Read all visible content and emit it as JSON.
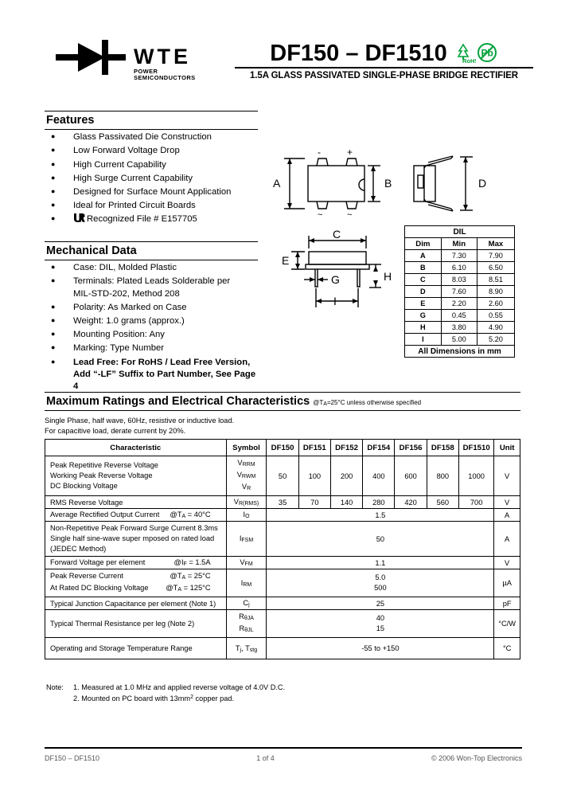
{
  "header": {
    "logo_text": "WTE",
    "logo_subtext": "POWER SEMICONDUCTORS",
    "title": "DF150 – DF1510",
    "subtitle": "1.5A GLASS PASSIVATED SINGLE-PHASE BRIDGE RECTIFIER",
    "rohs_label": "RoHS",
    "pb_label": "Pb"
  },
  "features": {
    "heading": "Features",
    "items": [
      "Glass Passivated Die Construction",
      "Low Forward Voltage Drop",
      "High Current Capability",
      "High Surge Current Capability",
      "Designed for Surface Mount Application",
      "Ideal for Printed Circuit Boards",
      "Recognized File # E157705"
    ],
    "ul_mark": "UR"
  },
  "mechanical": {
    "heading": "Mechanical Data",
    "items": [
      "Case: DIL, Molded Plastic",
      "Terminals: Plated Leads Solderable per",
      "Polarity: As Marked on Case",
      "Weight: 1.0 grams (approx.)",
      "Mounting Position: Any",
      "Marking: Type Number",
      "Lead Free: For RoHS / Lead Free Version,"
    ],
    "terminals_cont": "MIL-STD-202, Method 208",
    "leadfree_cont": "Add “-LF” Suffix to Part Number, See Page 4"
  },
  "drawing": {
    "labels": {
      "a": "A",
      "b": "B",
      "c": "C",
      "d": "D",
      "e": "E",
      "g": "G",
      "h": "H",
      "i": "I",
      "minus": "-",
      "plus": "+",
      "tilde1": "~",
      "tilde2": "~"
    }
  },
  "dil_table": {
    "title": "DIL",
    "headers": [
      "Dim",
      "Min",
      "Max"
    ],
    "rows": [
      [
        "A",
        "7.30",
        "7.90"
      ],
      [
        "B",
        "6.10",
        "6.50"
      ],
      [
        "C",
        "8.03",
        "8.51"
      ],
      [
        "D",
        "7.60",
        "8.90"
      ],
      [
        "E",
        "2.20",
        "2.60"
      ],
      [
        "G",
        "0.45",
        "0.55"
      ],
      [
        "H",
        "3.80",
        "4.90"
      ],
      [
        "I",
        "5.00",
        "5.20"
      ]
    ],
    "footer": "All Dimensions in mm"
  },
  "ratings": {
    "heading": "Maximum Ratings and Electrical Characteristics",
    "condition": "@TA=25°C unless otherwise specified",
    "note_line1": "Single Phase, half wave, 60Hz, resistive or inductive load.",
    "note_line2": "For capacitive load, derate current by 20%.",
    "headers": [
      "Characteristic",
      "Symbol",
      "DF150",
      "DF151",
      "DF152",
      "DF154",
      "DF156",
      "DF158",
      "DF1510",
      "Unit"
    ],
    "rows": [
      {
        "characteristic": [
          "Peak Repetitive Reverse Voltage",
          "Working Peak Reverse Voltage",
          "DC Blocking Voltage"
        ],
        "symbol": [
          "VRRM",
          "VRWM",
          "VR"
        ],
        "values": [
          "50",
          "100",
          "200",
          "400",
          "600",
          "800",
          "1000"
        ],
        "unit": "V"
      },
      {
        "characteristic": [
          "RMS Reverse Voltage"
        ],
        "symbol": [
          "VR(RMS)"
        ],
        "values": [
          "35",
          "70",
          "140",
          "280",
          "420",
          "560",
          "700"
        ],
        "unit": "V"
      },
      {
        "characteristic": [
          "Average Rectified Output Current"
        ],
        "cond": "@TA = 40°C",
        "symbol": [
          "IO"
        ],
        "span_value": "1.5",
        "unit": "A"
      },
      {
        "characteristic": [
          "Non-Repetitive Peak Forward Surge Current 8.3ms",
          "Single half sine-wave super mposed on rated load",
          "(JEDEC Method)"
        ],
        "symbol": [
          "IFSM"
        ],
        "span_value": "50",
        "unit": "A"
      },
      {
        "characteristic": [
          "Forward Voltage per element"
        ],
        "cond": "@I = 1.5A",
        "symbol": [
          "VFM"
        ],
        "span_value": "1.1",
        "unit": "V"
      },
      {
        "characteristic": [
          "Peak Reverse Current",
          "At Rated DC Blocking Voltage"
        ],
        "cond2": [
          "@TA = 25°C",
          "@TA = 125°C"
        ],
        "symbol": [
          "IRM"
        ],
        "span_values": [
          "5.0",
          "500"
        ],
        "unit": "µA"
      },
      {
        "characteristic": [
          "Typical Junction Capacitance per element (Note 1)"
        ],
        "symbol": [
          "Cj"
        ],
        "span_value": "25",
        "unit": "pF"
      },
      {
        "characteristic": [
          "Typical Thermal Resistance per leg (Note 2)"
        ],
        "symbol": [
          "RθJA",
          "RθJL"
        ],
        "span_values": [
          "40",
          "15"
        ],
        "unit": "°C/W"
      },
      {
        "characteristic": [
          "Operating and Storage Temperature Range"
        ],
        "symbol": [
          "Tj, Tstg"
        ],
        "span_value": "-55 to +150",
        "unit": "°C"
      }
    ]
  },
  "notes": {
    "label": "Note:",
    "note1": "1. Measured at 1.0 MHz and applied reverse voltage of 4.0V D.C.",
    "note2": "2. Mounted on PC board with 13mm2 copper pad."
  },
  "footer": {
    "left": "DF150 – DF1510",
    "center": "1 of 4",
    "right": "© 2006 Won-Top Electronics"
  },
  "colors": {
    "rohs_green": "#00a13a",
    "text": "#000000",
    "footer_text": "#555555"
  }
}
